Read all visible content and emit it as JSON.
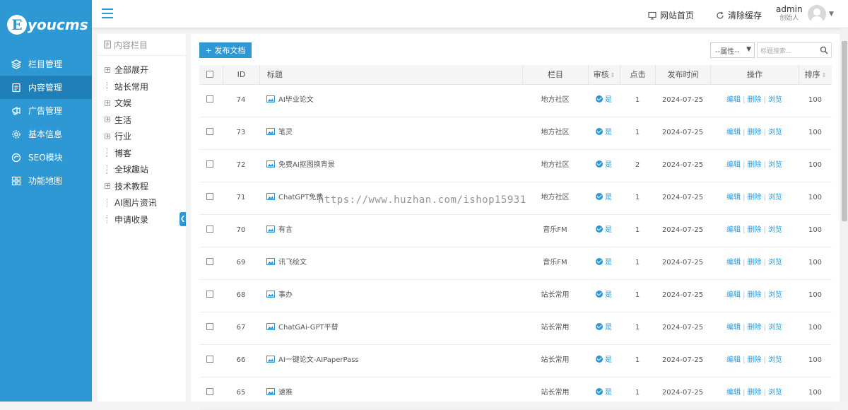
{
  "app": {
    "logo_letter": "E",
    "logo_text": "youcms",
    "brand_color": "#2d98d4"
  },
  "sidebar": {
    "items": [
      {
        "label": "栏目管理",
        "icon": "layers-icon"
      },
      {
        "label": "内容管理",
        "icon": "document-icon"
      },
      {
        "label": "广告管理",
        "icon": "megaphone-icon"
      },
      {
        "label": "基本信息",
        "icon": "gear-icon"
      },
      {
        "label": "SEO模块",
        "icon": "seo-icon"
      },
      {
        "label": "功能地图",
        "icon": "grid-icon"
      }
    ]
  },
  "header": {
    "home_label": "网站首页",
    "cache_label": "清除缓存",
    "user_name": "admin",
    "user_role": "创始人"
  },
  "tree": {
    "title": "内容栏目",
    "items": [
      "全部展开",
      "站长常用",
      "文娱",
      "生活",
      "行业",
      "博客",
      "全球趣站",
      "技术教程",
      "AI图片资讯",
      "申请收录"
    ]
  },
  "toolbar": {
    "publish_label": "+ 发布文档",
    "attr_select": "--属性--",
    "search_placeholder": "标题搜索..."
  },
  "table": {
    "headers": {
      "id": "ID",
      "title": "标题",
      "column": "栏目",
      "review": "审核",
      "clicks": "点击",
      "date": "发布时间",
      "ops": "操作",
      "sort": "排序"
    },
    "op_labels": {
      "edit": "编辑",
      "delete": "删除",
      "view": "浏览"
    },
    "rows": [
      {
        "id": "74",
        "title": "AI毕业论文",
        "column": "地方社区",
        "review": "是",
        "clicks": "1",
        "date": "2024-07-25",
        "sort": "100"
      },
      {
        "id": "73",
        "title": "笔灵",
        "column": "地方社区",
        "review": "是",
        "clicks": "1",
        "date": "2024-07-25",
        "sort": "100"
      },
      {
        "id": "72",
        "title": "免费AI抠图换背景",
        "column": "地方社区",
        "review": "是",
        "clicks": "2",
        "date": "2024-07-25",
        "sort": "100"
      },
      {
        "id": "71",
        "title": "ChatGPT免费",
        "column": "地方社区",
        "review": "是",
        "clicks": "1",
        "date": "2024-07-25",
        "sort": "100"
      },
      {
        "id": "70",
        "title": "有言",
        "column": "音乐FM",
        "review": "是",
        "clicks": "1",
        "date": "2024-07-25",
        "sort": "100"
      },
      {
        "id": "69",
        "title": "讯飞绘文",
        "column": "音乐FM",
        "review": "是",
        "clicks": "1",
        "date": "2024-07-25",
        "sort": "100"
      },
      {
        "id": "68",
        "title": "事办",
        "column": "站长常用",
        "review": "是",
        "clicks": "1",
        "date": "2024-07-25",
        "sort": "100"
      },
      {
        "id": "67",
        "title": "ChatGAi-GPT平替",
        "column": "站长常用",
        "review": "是",
        "clicks": "1",
        "date": "2024-07-25",
        "sort": "100"
      },
      {
        "id": "66",
        "title": "AI一键论文-AIPaperPass",
        "column": "站长常用",
        "review": "是",
        "clicks": "1",
        "date": "2024-07-25",
        "sort": "100"
      },
      {
        "id": "65",
        "title": "速推",
        "column": "站长常用",
        "review": "是",
        "clicks": "1",
        "date": "2024-07-25",
        "sort": "100"
      }
    ]
  },
  "watermark": "https://www.huzhan.com/ishop15931"
}
